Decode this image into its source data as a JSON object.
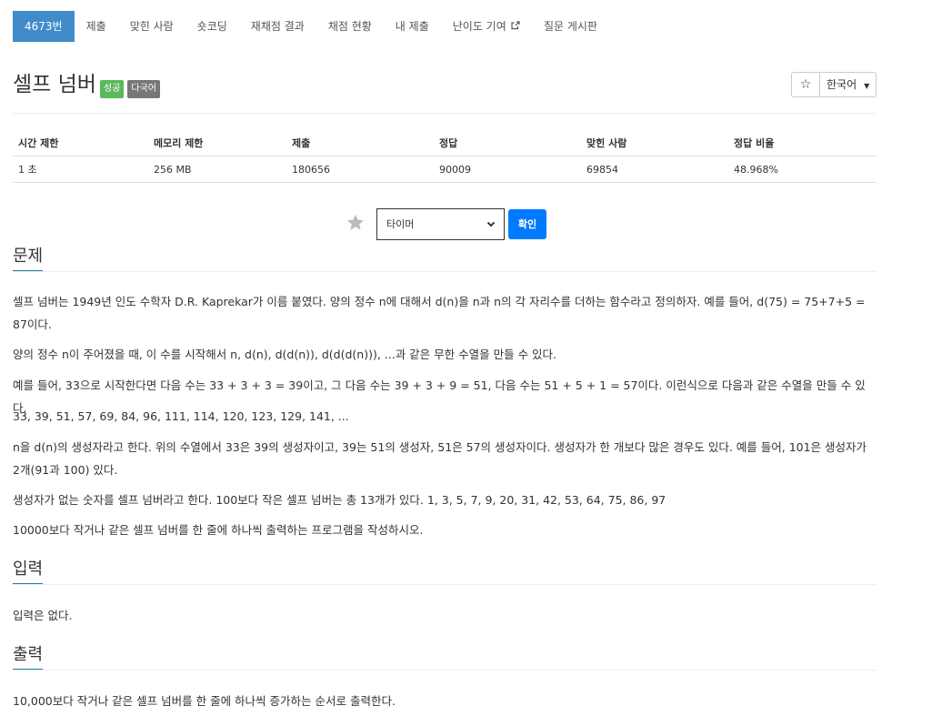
{
  "nav": {
    "items": [
      {
        "label": "4673번",
        "active": true
      },
      {
        "label": "제출"
      },
      {
        "label": "맞힌 사람"
      },
      {
        "label": "숏코딩"
      },
      {
        "label": "재채점 결과"
      },
      {
        "label": "채점 현황"
      },
      {
        "label": "내 제출"
      },
      {
        "label": "난이도 기여",
        "external_icon": "external-link-icon"
      },
      {
        "label": "질문 게시판"
      }
    ]
  },
  "problem": {
    "title": "셀프 넘버",
    "badges": {
      "success": "성공",
      "multi": "다국어"
    },
    "star_icon": "star-outline-icon",
    "language": "한국어"
  },
  "info_table": {
    "headers": [
      "시간 제한",
      "메모리 제한",
      "제출",
      "정답",
      "맞힌 사람",
      "정답 비율"
    ],
    "row": [
      "1 초",
      "256 MB",
      "180656",
      "90009",
      "69854",
      "48.968%"
    ]
  },
  "timer": {
    "star_icon": "star-filled-icon",
    "selected": "타이머",
    "confirm_label": "확인"
  },
  "sections": {
    "problem_title": "문제",
    "problem_paragraphs": [
      "셀프 넘버는 1949년 인도 수학자 D.R. Kaprekar가 이름 붙였다. 양의 정수 n에 대해서 d(n)을 n과 n의 각 자리수를 더하는 함수라고 정의하자. 예를 들어, d(75) = 75+7+5 = 87이다.",
      "양의 정수 n이 주어졌을 때, 이 수를 시작해서 n, d(n), d(d(n)), d(d(d(n))), ...과 같은 무한 수열을 만들 수 있다.",
      "예를 들어, 33으로 시작한다면 다음 수는 33 + 3 + 3 = 39이고, 그 다음 수는 39 + 3 + 9 = 51, 다음 수는 51 + 5 + 1 = 57이다. 이런식으로 다음과 같은 수열을 만들 수 있다.",
      "33, 39, 51, 57, 69, 84, 96, 111, 114, 120, 123, 129, 141, ...",
      "n을 d(n)의 생성자라고 한다. 위의 수열에서 33은 39의 생성자이고, 39는 51의 생성자, 51은 57의 생성자이다. 생성자가 한 개보다 많은 경우도 있다. 예를 들어, 101은 생성자가 2개(91과 100) 있다.",
      "생성자가 없는 숫자를 셀프 넘버라고 한다. 100보다 작은 셀프 넘버는 총 13개가 있다. 1, 3, 5, 7, 9, 20, 31, 42, 53, 64, 75, 86, 97",
      "10000보다 작거나 같은 셀프 넘버를 한 줄에 하나씩 출력하는 프로그램을 작성하시오."
    ],
    "input_title": "입력",
    "input_text": "입력은 없다.",
    "output_title": "출력",
    "output_text": "10,000보다 작거나 같은 셀프 넘버를 한 줄에 하나씩 증가하는 순서로 출력한다."
  },
  "colors": {
    "nav_active": "#428bca",
    "badge_success": "#5cb85c",
    "badge_multi": "#777777",
    "confirm_button": "#007bff",
    "section_underline": "#1b7da2"
  }
}
